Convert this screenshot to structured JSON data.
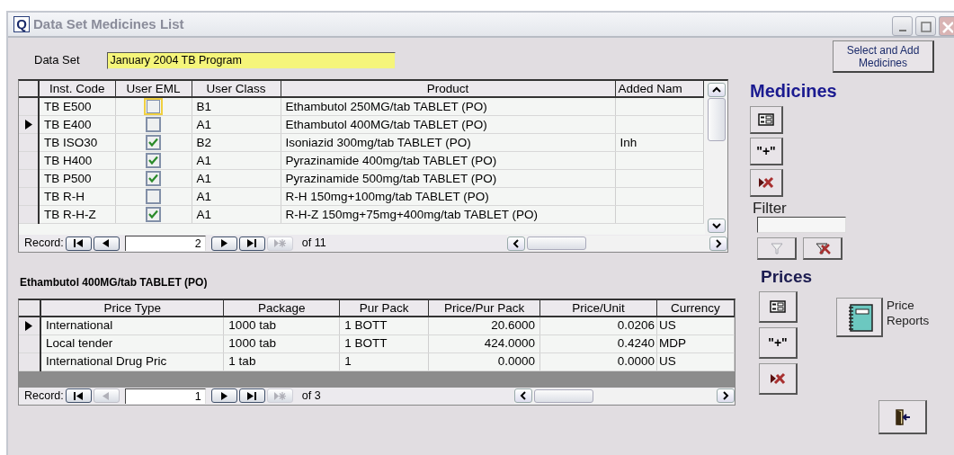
{
  "window": {
    "icon_letter": "Q",
    "title": "Data Set Medicines List"
  },
  "data_set": {
    "label": "Data Set",
    "value": "January 2004 TB Program"
  },
  "select_add_button": "Select and Add Medicines",
  "medicines": {
    "columns": [
      "Inst. Code",
      "User EML",
      "User Class",
      "Product",
      "Added Nam"
    ],
    "rows": [
      {
        "code": "TB E500",
        "eml_checked": false,
        "eml_focused": true,
        "class": "B1",
        "product": "Ethambutol 250MG/tab TABLET (PO)",
        "added_name": "",
        "selected": false
      },
      {
        "code": "TB E400",
        "eml_checked": false,
        "eml_focused": false,
        "class": "A1",
        "product": "Ethambutol 400MG/tab TABLET (PO)",
        "added_name": "",
        "selected": true
      },
      {
        "code": "TB ISO30",
        "eml_checked": true,
        "eml_focused": false,
        "class": "B2",
        "product": "Isoniazid 300mg/tab TABLET (PO)",
        "added_name": "Inh",
        "selected": false
      },
      {
        "code": "TB H400",
        "eml_checked": true,
        "eml_focused": false,
        "class": "A1",
        "product": "Pyrazinamide 400mg/tab TABLET (PO)",
        "added_name": "",
        "selected": false
      },
      {
        "code": "TB P500",
        "eml_checked": true,
        "eml_focused": false,
        "class": "A1",
        "product": "Pyrazinamide 500mg/tab TABLET (PO)",
        "added_name": "",
        "selected": false
      },
      {
        "code": "TB R-H",
        "eml_checked": false,
        "eml_focused": false,
        "class": "A1",
        "product": "R-H 150mg+100mg/tab TABLET (PO)",
        "added_name": "",
        "selected": false
      },
      {
        "code": "TB R-H-Z",
        "eml_checked": true,
        "eml_focused": false,
        "class": "A1",
        "product": "R-H-Z 150mg+75mg+400mg/tab TABLET (PO)",
        "added_name": "",
        "selected": false
      }
    ],
    "navigator": {
      "label": "Record:",
      "current": "2",
      "total": "of 11",
      "buttons": [
        {
          "kind": "first",
          "disabled": false
        },
        {
          "kind": "prev",
          "disabled": false
        },
        {
          "kind": "next",
          "disabled": false
        },
        {
          "kind": "last",
          "disabled": false
        },
        {
          "kind": "new",
          "disabled": true
        }
      ]
    }
  },
  "price_heading": "Ethambutol 400MG/tab TABLET (PO)",
  "prices": {
    "columns": [
      "Price Type",
      "Package",
      "Pur Pack",
      "Price/Pur Pack",
      "Price/Unit",
      "Currency"
    ],
    "rows": [
      {
        "cells": [
          "International",
          "1000 tab",
          "1 BOTT",
          "20.6000",
          "0.0206",
          "US"
        ],
        "selected": true
      },
      {
        "cells": [
          "Local tender",
          "1000 tab",
          "1 BOTT",
          "424.0000",
          "0.4240",
          "MDP"
        ],
        "selected": false
      },
      {
        "cells": [
          "International Drug Pric",
          "1 tab",
          "1",
          "0.0000",
          "0.0000",
          "US"
        ],
        "selected": false
      }
    ],
    "navigator": {
      "label": "Record:",
      "current": "1",
      "total": "of 3",
      "buttons": [
        {
          "kind": "first",
          "disabled": false
        },
        {
          "kind": "prev",
          "disabled": true
        },
        {
          "kind": "next",
          "disabled": false
        },
        {
          "kind": "last",
          "disabled": false
        },
        {
          "kind": "new",
          "disabled": true
        }
      ]
    }
  },
  "side": {
    "medicines_title": "Medicines",
    "medicine_buttons": [
      {
        "kind": "form"
      },
      {
        "kind": "add",
        "text": "\"+\""
      },
      {
        "kind": "delete"
      }
    ],
    "filter_label": "Filter",
    "filter_buttons": [
      {
        "kind": "filter",
        "disabled": true
      },
      {
        "kind": "remove-filter",
        "disabled": false
      }
    ],
    "prices_title": "Prices",
    "price_buttons": [
      {
        "kind": "form"
      },
      {
        "kind": "add",
        "text": "\"+\""
      },
      {
        "kind": "delete"
      }
    ],
    "reports_label": "Price Reports"
  }
}
